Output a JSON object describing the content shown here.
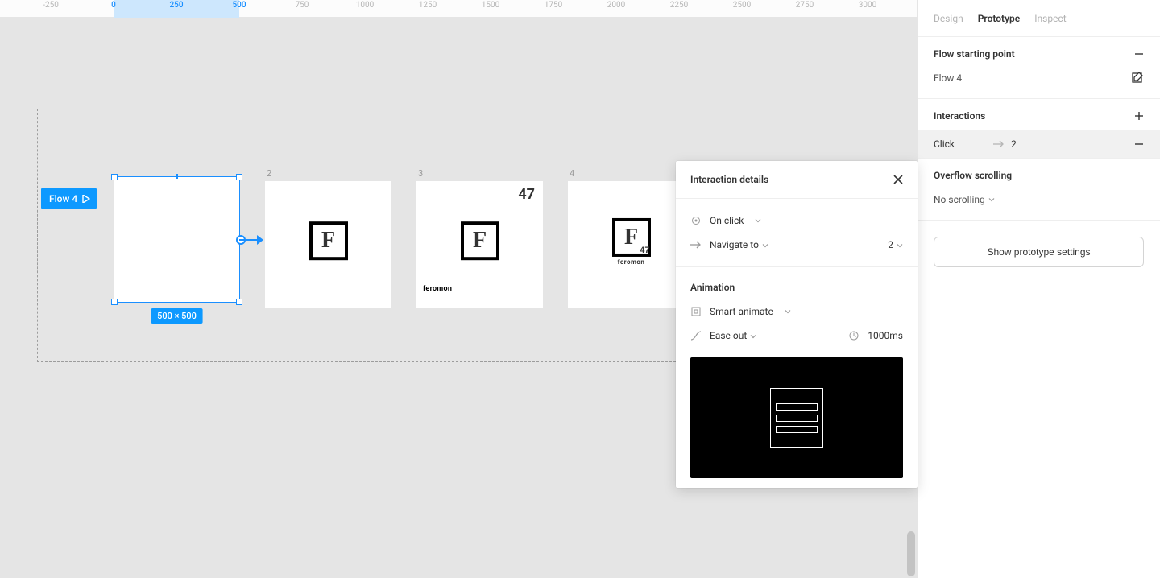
{
  "ruler": {
    "ticks": [
      {
        "pos": 63,
        "label": "-250",
        "active": false
      },
      {
        "pos": 141,
        "label": "0",
        "active": true
      },
      {
        "pos": 219,
        "label": "250",
        "active": true
      },
      {
        "pos": 297,
        "label": "500",
        "active": true
      },
      {
        "pos": 375,
        "label": "750",
        "active": false
      },
      {
        "pos": 453,
        "label": "1000",
        "active": false
      },
      {
        "pos": 531,
        "label": "1250",
        "active": false
      },
      {
        "pos": 609,
        "label": "1500",
        "active": false
      },
      {
        "pos": 687,
        "label": "1750",
        "active": false
      },
      {
        "pos": 765,
        "label": "2000",
        "active": false
      },
      {
        "pos": 843,
        "label": "2250",
        "active": false
      },
      {
        "pos": 921,
        "label": "2500",
        "active": false
      },
      {
        "pos": 999,
        "label": "2750",
        "active": false
      },
      {
        "pos": 1077,
        "label": "3000",
        "active": false
      }
    ]
  },
  "canvas": {
    "flow_tag": "Flow 4",
    "dimensions_badge": "500 × 500",
    "frames": {
      "f2": "2",
      "f3": "3",
      "f3_corner": "47",
      "f3_text": "feromon",
      "f4": "4",
      "f4_sub": "47",
      "f4_text": "feromon"
    }
  },
  "popover": {
    "title": "Interaction details",
    "trigger": "On click",
    "action": "Navigate to",
    "target": "2",
    "animation_heading": "Animation",
    "animation_type": "Smart animate",
    "easing": "Ease out",
    "duration": "1000ms"
  },
  "panel": {
    "tabs": {
      "design": "Design",
      "prototype": "Prototype",
      "inspect": "Inspect"
    },
    "flow_heading": "Flow starting point",
    "flow_name": "Flow 4",
    "interactions_heading": "Interactions",
    "interaction_trigger": "Click",
    "interaction_target": "2",
    "overflow_heading": "Overflow scrolling",
    "overflow_value": "No scrolling",
    "settings_btn": "Show prototype settings"
  }
}
